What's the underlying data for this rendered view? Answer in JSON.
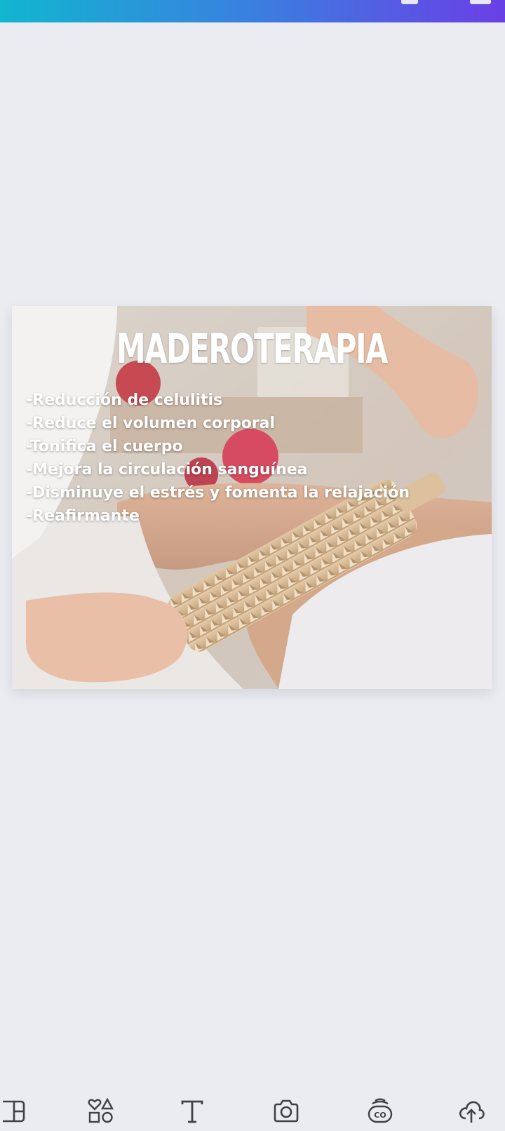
{
  "design": {
    "title": "MADEROTERAPIA",
    "benefits": [
      "-Reducción de celulitis",
      "-Reduce el volumen corporal",
      "-Tonifica el cuerpo",
      "-Mejora la circulación sanguínea",
      "-Disminuye el estrés y fomenta la relajación",
      "-Reafirmante"
    ]
  },
  "colors": {
    "background": "#ebecf1",
    "gradient_start": "#11b6cf",
    "gradient_end": "#6a3fe6",
    "icon": "#3f4148"
  },
  "toolbar": {
    "items": [
      {
        "icon": "templates-icon"
      },
      {
        "icon": "elements-icon"
      },
      {
        "icon": "text-icon"
      },
      {
        "icon": "camera-icon"
      },
      {
        "icon": "brand-icon"
      },
      {
        "icon": "upload-icon"
      }
    ]
  }
}
